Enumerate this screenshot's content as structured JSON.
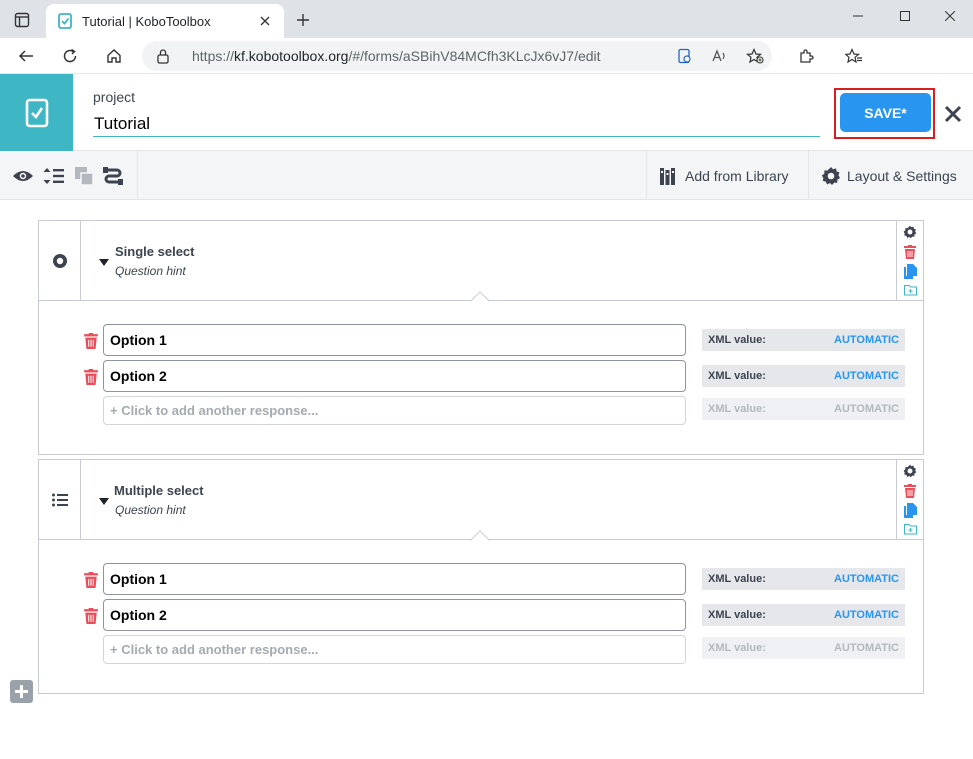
{
  "browser": {
    "tab_title": "Tutorial | KoboToolbox",
    "url_prefix": "https://",
    "url_host": "kf.kobotoolbox.org",
    "url_path": "/#/forms/aSBihV84MCfh3KLcJx6vJ7/edit"
  },
  "header": {
    "project_label": "project",
    "project_name": "Tutorial",
    "save_label": "SAVE*"
  },
  "fb_toolbar": {
    "add_from_library": "Add from Library",
    "layout_settings": "Layout & Settings"
  },
  "questions": [
    {
      "type": "Single select",
      "label": "Single select",
      "hint": "Question hint",
      "options": [
        {
          "label": "Option 1",
          "xml_key": "XML value:",
          "xml_value": "AUTOMATIC"
        },
        {
          "label": "Option 2",
          "xml_key": "XML value:",
          "xml_value": "AUTOMATIC"
        }
      ],
      "add_placeholder": "+ Click to add another response...",
      "add_xml_key": "XML value:",
      "add_xml_value": "AUTOMATIC"
    },
    {
      "type": "Multiple select",
      "label": "Multiple select",
      "hint": "Question hint",
      "options": [
        {
          "label": "Option 1",
          "xml_key": "XML value:",
          "xml_value": "AUTOMATIC"
        },
        {
          "label": "Option 2",
          "xml_key": "XML value:",
          "xml_value": "AUTOMATIC"
        }
      ],
      "add_placeholder": "+ Click to add another response...",
      "add_xml_key": "XML value:",
      "add_xml_value": "AUTOMATIC"
    }
  ],
  "colors": {
    "brand_teal": "#3fb6c4",
    "save_blue": "#2896f0",
    "delete_red": "#ea4e5b",
    "highlight_red": "#d81f1f"
  }
}
